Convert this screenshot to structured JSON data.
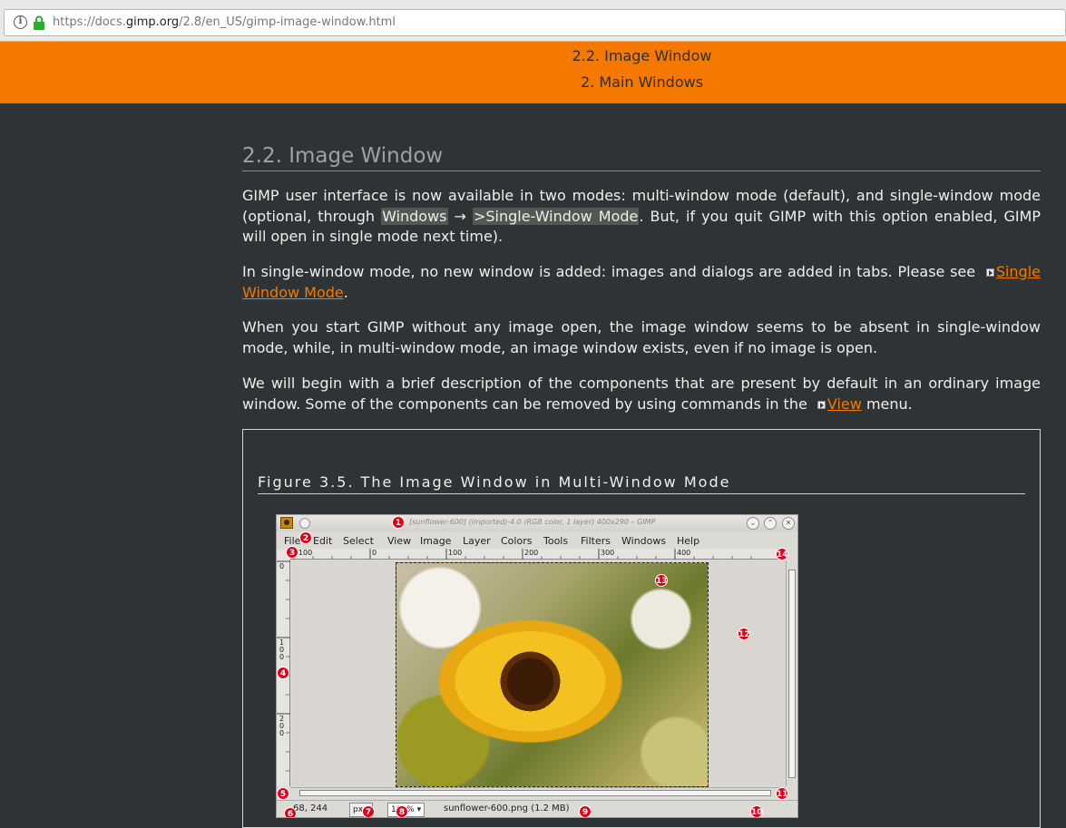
{
  "browser": {
    "url_prefix": "https://docs.",
    "url_domain": "gimp.org",
    "url_path": "/2.8/en_US/gimp-image-window.html"
  },
  "header": {
    "line1": "2.2. Image Window",
    "line2": "2. Main Windows"
  },
  "section": {
    "title": "2.2. Image Window",
    "p1_a": "GIMP user interface is now available in two modes: multi-window mode (default), and single-window mode (optional, through ",
    "p1_menu1": "Windows",
    "p1_arrow": " → ",
    "p1_menu2": ">Single-Window Mode",
    "p1_b": ". But, if you quit GIMP with this option enabled, GIMP will open in single mode next time).",
    "p2_a": "In single-window mode, no new window is added: images and dialogs are added in tabs. Please see ",
    "p2_link": "Single Window Mode",
    "p2_b": ".",
    "p3": "When you start GIMP without any image open, the image window seems to be absent in single-window mode, while, in multi-window mode, an image window exists, even if no image is open.",
    "p4_a": "We will begin with a brief description of the components that are present by default in an ordinary image window. Some of the components can be removed by using commands in the ",
    "p4_link": "View",
    "p4_b": " menu."
  },
  "figure": {
    "title": "Figure 3.5. The Image Window in Multi-Window Mode"
  },
  "gimp": {
    "title": "[sunflower-600] (imported)-4.0 (RGB color, 1 layer) 400x290 – GIMP",
    "menus": [
      "File",
      "Edit",
      "Select",
      "View",
      "Image",
      "Layer",
      "Colors",
      "Tools",
      "Filters",
      "Windows",
      "Help"
    ],
    "ruler_top": [
      "-100",
      "0",
      "100",
      "200",
      "300",
      "400"
    ],
    "ruler_left": [
      "0",
      "1\n0\n0",
      "2\n0\n0"
    ],
    "coords": "68, 244",
    "unit": "px",
    "zoom": "100%",
    "status": "sunflower-600.png (1.2 MB)",
    "callouts": [
      "1",
      "2",
      "3",
      "4",
      "5",
      "6",
      "7",
      "8",
      "9",
      "10",
      "11",
      "12",
      "13",
      "14"
    ]
  }
}
